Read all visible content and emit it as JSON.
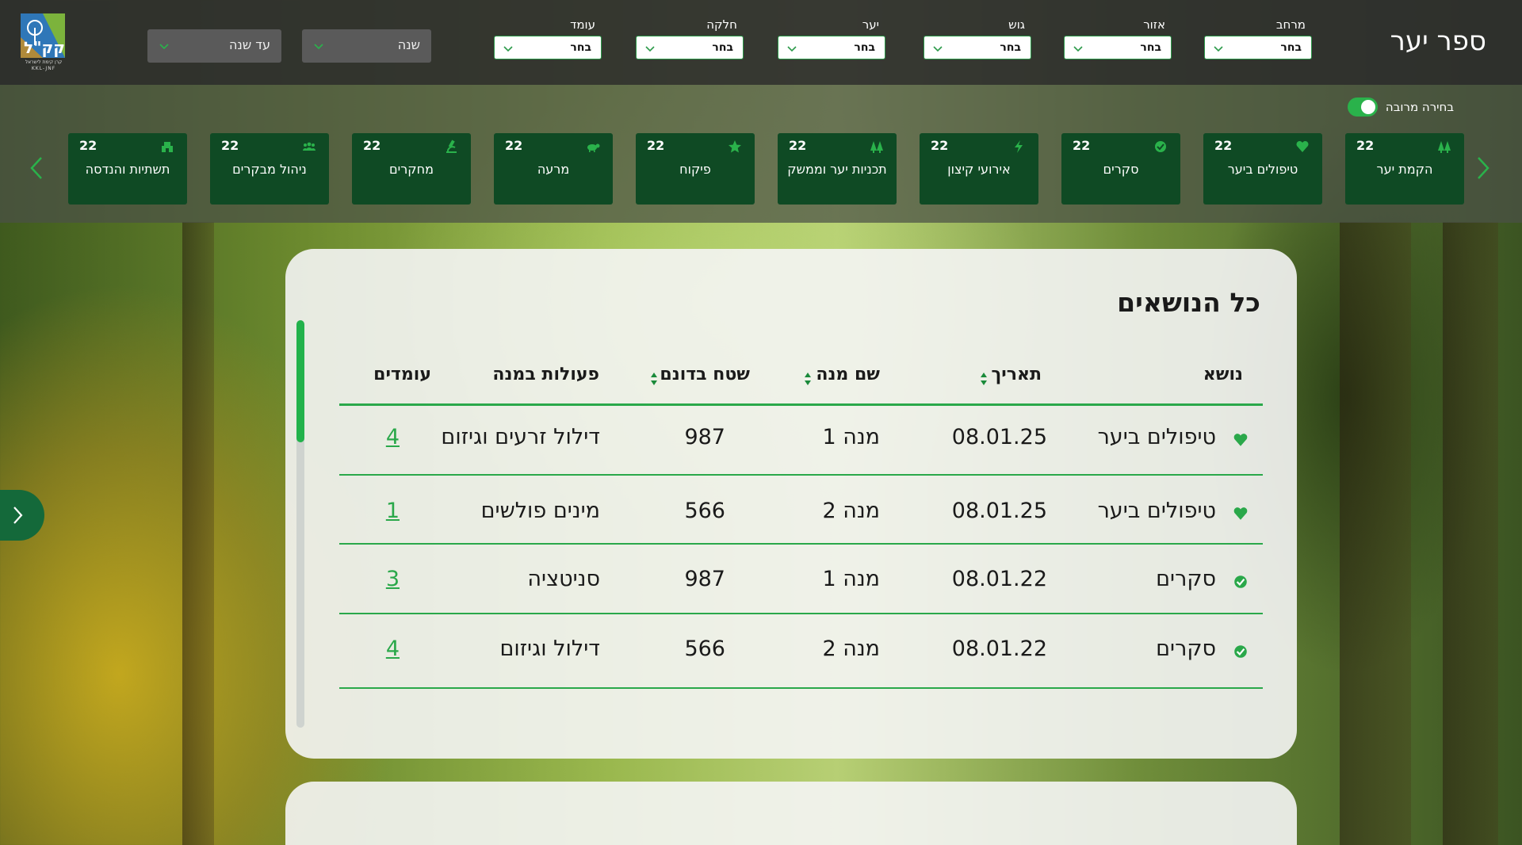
{
  "header": {
    "title": "ספר יער",
    "logo_text": "קק\"ל",
    "logo_caption": "קרן קימת לישראל",
    "logo_sub": "KKL-JNF",
    "filters": [
      {
        "label": "מרחב",
        "value": "בחר"
      },
      {
        "label": "אזור",
        "value": "בחר"
      },
      {
        "label": "גוש",
        "value": "בחר"
      },
      {
        "label": "יער",
        "value": "בחר"
      },
      {
        "label": "חלקה",
        "value": "בחר"
      },
      {
        "label": "עומד",
        "value": "בחר"
      }
    ],
    "year_from": "שנה",
    "year_to": "עד שנה"
  },
  "strip": {
    "multi_select_label": "בחירה מרובה",
    "multi_select_on": true,
    "categories": [
      {
        "name": "הקמת יער",
        "count": "22",
        "icon": "trees-icon"
      },
      {
        "name": "טיפולים ביער",
        "count": "22",
        "icon": "heart-icon"
      },
      {
        "name": "סקרים",
        "count": "22",
        "icon": "survey-icon"
      },
      {
        "name": "אירועי קיצון",
        "count": "22",
        "icon": "lightning-icon"
      },
      {
        "name": "תכניות יער וממשק",
        "count": "22",
        "icon": "forest-plan-icon"
      },
      {
        "name": "פיקוח",
        "count": "22",
        "icon": "star-icon"
      },
      {
        "name": "מרעה",
        "count": "22",
        "icon": "cow-icon"
      },
      {
        "name": "מחקרים",
        "count": "22",
        "icon": "microscope-icon"
      },
      {
        "name": "ניהול מבקרים",
        "count": "22",
        "icon": "visitors-icon"
      },
      {
        "name": "תשתיות והנדסה",
        "count": "22",
        "icon": "engineering-icon"
      }
    ]
  },
  "table": {
    "title": "כל הנושאים",
    "columns": [
      "נושא",
      "תאריך",
      "שם מנה",
      "שטח בדונם",
      "פעולות במנה",
      "עומדים"
    ],
    "rows": [
      {
        "topic": "טיפולים ביער",
        "icon": "heart-icon",
        "date": "08.01.25",
        "portion": "מנה 1",
        "area": "987",
        "actions": "דילול זרעים וגיזום",
        "stands": "4"
      },
      {
        "topic": "טיפולים ביער",
        "icon": "heart-icon",
        "date": "08.01.25",
        "portion": "מנה 2",
        "area": "566",
        "actions": "מינים פולשים",
        "stands": "1"
      },
      {
        "topic": "סקרים",
        "icon": "survey-icon",
        "date": "08.01.22",
        "portion": "מנה 1",
        "area": "987",
        "actions": "סניטציה",
        "stands": "3"
      },
      {
        "topic": "סקרים",
        "icon": "survey-icon",
        "date": "08.01.22",
        "portion": "מנה 2",
        "area": "566",
        "actions": "דילול וגיזום",
        "stands": "4"
      }
    ]
  },
  "colors": {
    "accent": "#2aa84a",
    "card_dark": "#0f4a24",
    "header_bg": "#2d2d2d"
  }
}
